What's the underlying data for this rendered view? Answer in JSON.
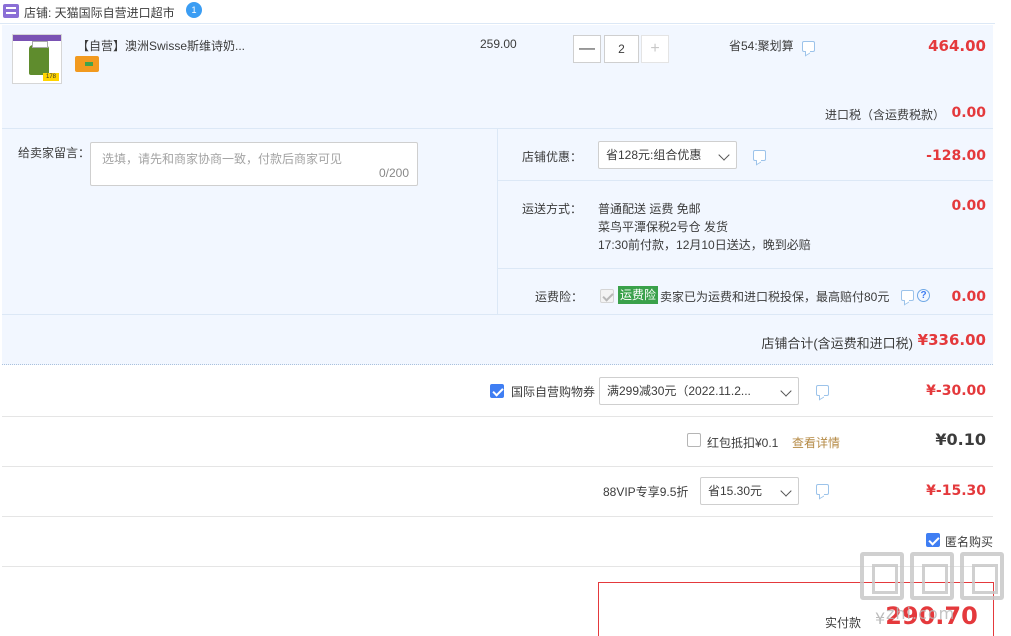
{
  "store": {
    "label": "店铺: 天猫国际自营进口超市",
    "badge": "1"
  },
  "item": {
    "thumb_tag": "178",
    "title": "【自营】澳洲Swisse斯维诗奶...",
    "unit_price": "259.00",
    "quantity": "2",
    "minus_label": "—",
    "plus_label": "+",
    "promo": "省54:聚划算",
    "total": "464.00"
  },
  "tax": {
    "label": "进口税（含运费税款）",
    "value": "0.00"
  },
  "memo": {
    "label": "给卖家留言：",
    "placeholder": "选填，请先和商家协商一致，付款后商家可见",
    "count": "0/200"
  },
  "store_discount": {
    "label": "店铺优惠：",
    "selected": "省128元:组合优惠",
    "amount": "-128.00"
  },
  "shipping": {
    "label": "运送方式：",
    "line1": "普通配送 运费 免邮",
    "line2": "菜鸟平潭保税2号仓  发货",
    "line3": "17:30前付款，12月10日送达，晚到必赔",
    "amount": "0.00"
  },
  "insurance": {
    "label": "运费险：",
    "tag": "运费险",
    "text": "卖家已为运费和进口税投保，最高赔付80元",
    "help": "?",
    "amount": "0.00"
  },
  "store_total": {
    "label": "店铺合计(含运费和进口税)",
    "value": "¥336.00"
  },
  "coupon": {
    "label": "国际自营购物券",
    "selected": "满299减30元（2022.11.2...",
    "amount": "¥-30.00"
  },
  "red_packet": {
    "label": "红包抵扣¥0.1",
    "link": "查看详情",
    "amount": "¥0.10"
  },
  "vip": {
    "label": "88VIP专享9.5折",
    "selected": "省15.30元",
    "amount": "¥-15.30"
  },
  "anonymous": {
    "label": "匿名购买"
  },
  "payment": {
    "label": "实付款",
    "currency": "¥",
    "amount": "290.70"
  },
  "watermark": {
    "text": "zhi.com"
  },
  "colors": {
    "accent_red": "#e4393c",
    "panel_bg": "#f2f7ff",
    "checkbox_blue": "#3f7ef3",
    "insurance_green": "#3aa14a",
    "link_brown": "#b58a45"
  }
}
